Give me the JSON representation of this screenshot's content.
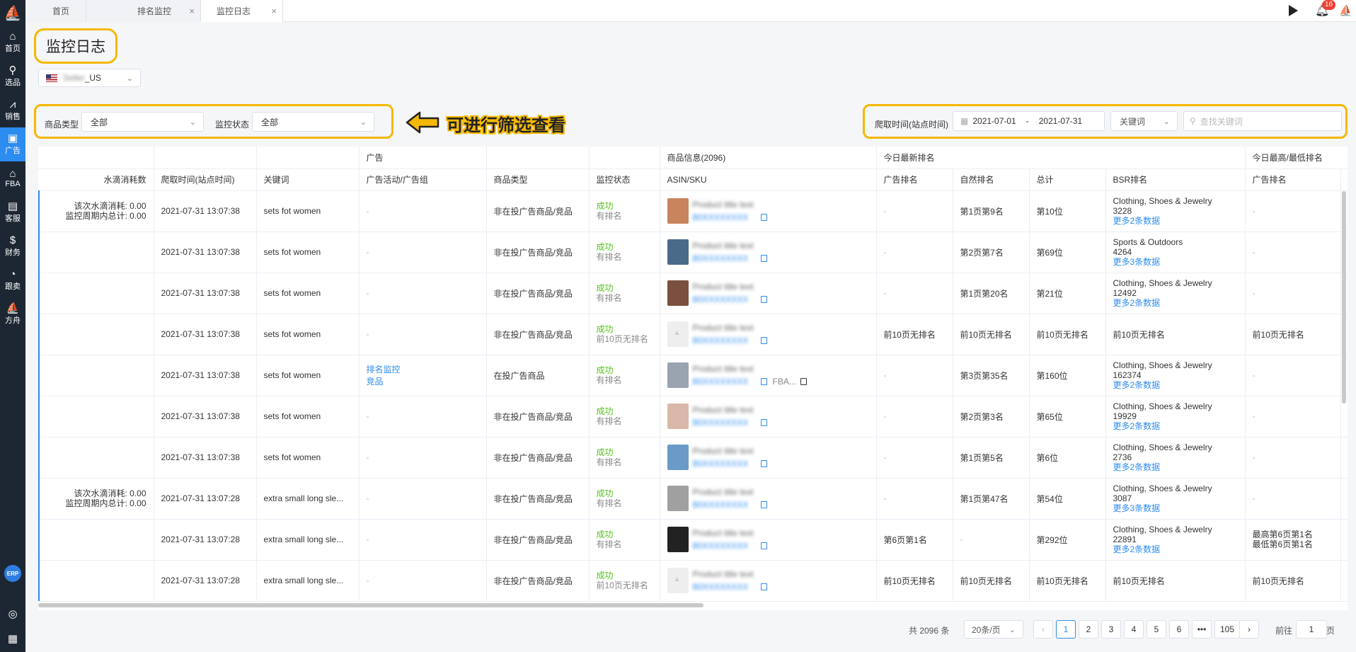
{
  "sidebar": [
    {
      "label": "首页",
      "icon": "home-icon",
      "glyph": "⌂"
    },
    {
      "label": "选品",
      "icon": "search-icon",
      "glyph": "⚲"
    },
    {
      "label": "销售",
      "icon": "chart-icon",
      "glyph": "⩘"
    },
    {
      "label": "广告",
      "icon": "ad-icon",
      "glyph": "▣"
    },
    {
      "label": "FBA",
      "icon": "warehouse-icon",
      "glyph": "⌂"
    },
    {
      "label": "客服",
      "icon": "service-icon",
      "glyph": "▤"
    },
    {
      "label": "财务",
      "icon": "finance-icon",
      "glyph": "$"
    },
    {
      "label": "跟卖",
      "icon": "follow-icon",
      "glyph": "◔"
    },
    {
      "label": "方舟",
      "icon": "ark-icon",
      "glyph": "⛵"
    }
  ],
  "erp_label": "ERP",
  "tabs": [
    {
      "label": "首页"
    },
    {
      "label": "排名监控"
    },
    {
      "label": "监控日志"
    }
  ],
  "notifications": "16",
  "page_title": "监控日志",
  "market": {
    "suffix": "_US"
  },
  "filters": {
    "type_label": "商品类型",
    "type_value": "全部",
    "status_label": "监控状态",
    "status_value": "全部",
    "note": "可进行筛选查看",
    "crawl_label": "爬取时间(站点时间)",
    "date_start": "2021-07-01",
    "date_sep": "-",
    "date_end": "2021-07-31",
    "kw_select": "关键词",
    "search_placeholder": "查找关键词"
  },
  "table": {
    "group_headers": {
      "ad": "广告",
      "product": "商品信息(2096)",
      "latest": "今日最新排名",
      "hilo": "今日最高/最低排名"
    },
    "columns": [
      "水滴消耗数",
      "爬取时间(站点时间)",
      "关键词",
      "广告活动/广告组",
      "商品类型",
      "监控状态",
      "ASIN/SKU",
      "广告排名",
      "自然排名",
      "总计",
      "BSR排名",
      "广告排名"
    ],
    "rows": [
      {
        "cost1": "该次水滴消耗: 0.00",
        "cost2": "监控周期内总计: 0.00",
        "time": "2021-07-31 13:07:38",
        "kw": "sets fot women",
        "ad1": "-",
        "ad2": "",
        "ptype": "非在投广告商品/竞品",
        "s1": "成功",
        "s2": "有排名",
        "adrank": "-",
        "nat": "第1页第9名",
        "total": "第10位",
        "bsr1": "Clothing, Shoes & Jewelry",
        "bsr2": "3228",
        "bsr3": "更多2条数据",
        "hl1": "-",
        "hl2": "",
        "thumb": "#c8845c"
      },
      {
        "cost1": "",
        "cost2": "",
        "time": "2021-07-31 13:07:38",
        "kw": "sets fot women",
        "ad1": "-",
        "ad2": "",
        "ptype": "非在投广告商品/竞品",
        "s1": "成功",
        "s2": "有排名",
        "adrank": "-",
        "nat": "第2页第7名",
        "total": "第69位",
        "bsr1": "Sports & Outdoors",
        "bsr2": "4264",
        "bsr3": "更多3条数据",
        "hl1": "-",
        "hl2": "",
        "thumb": "#4a6a8a"
      },
      {
        "cost1": "",
        "cost2": "",
        "time": "2021-07-31 13:07:38",
        "kw": "sets fot women",
        "ad1": "-",
        "ad2": "",
        "ptype": "非在投广告商品/竞品",
        "s1": "成功",
        "s2": "有排名",
        "adrank": "-",
        "nat": "第1页第20名",
        "total": "第21位",
        "bsr1": "Clothing, Shoes & Jewelry",
        "bsr2": "12492",
        "bsr3": "更多2条数据",
        "hl1": "-",
        "hl2": "",
        "thumb": "#7a5040"
      },
      {
        "cost1": "",
        "cost2": "",
        "time": "2021-07-31 13:07:38",
        "kw": "sets fot women",
        "ad1": "-",
        "ad2": "",
        "ptype": "非在投广告商品/竞品",
        "s1": "成功",
        "s2": "前10页无排名",
        "adrank": "前10页无排名",
        "nat": "前10页无排名",
        "total": "前10页无排名",
        "bsr1": "前10页无排名",
        "bsr2": "",
        "bsr3": "",
        "hl1": "前10页无排名",
        "hl2": "",
        "thumb": "none"
      },
      {
        "cost1": "",
        "cost2": "",
        "time": "2021-07-31 13:07:38",
        "kw": "sets fot women",
        "ad1": "排名监控",
        "ad2": "竞品",
        "ptype": "在投广告商品",
        "s1": "成功",
        "s2": "有排名",
        "adrank": "-",
        "nat": "第3页第35名",
        "total": "第160位",
        "bsr1": "Clothing, Shoes & Jewelry",
        "bsr2": "162374",
        "bsr3": "更多2条数据",
        "hl1": "-",
        "hl2": "",
        "thumb": "#9aa3b0",
        "fba": "FBA..."
      },
      {
        "cost1": "",
        "cost2": "",
        "time": "2021-07-31 13:07:38",
        "kw": "sets fot women",
        "ad1": "-",
        "ad2": "",
        "ptype": "非在投广告商品/竞品",
        "s1": "成功",
        "s2": "有排名",
        "adrank": "-",
        "nat": "第2页第3名",
        "total": "第65位",
        "bsr1": "Clothing, Shoes & Jewelry",
        "bsr2": "19929",
        "bsr3": "更多2条数据",
        "hl1": "-",
        "hl2": "",
        "thumb": "#d8b8a8"
      },
      {
        "cost1": "",
        "cost2": "",
        "time": "2021-07-31 13:07:38",
        "kw": "sets fot women",
        "ad1": "-",
        "ad2": "",
        "ptype": "非在投广告商品/竞品",
        "s1": "成功",
        "s2": "有排名",
        "adrank": "-",
        "nat": "第1页第5名",
        "total": "第6位",
        "bsr1": "Clothing, Shoes & Jewelry",
        "bsr2": "2736",
        "bsr3": "更多2条数据",
        "hl1": "-",
        "hl2": "",
        "thumb": "#6a9ac8"
      },
      {
        "cost1": "该次水滴消耗: 0.00",
        "cost2": "监控周期内总计: 0.00",
        "time": "2021-07-31 13:07:28",
        "kw": "extra small long sle...",
        "ad1": "-",
        "ad2": "",
        "ptype": "非在投广告商品/竞品",
        "s1": "成功",
        "s2": "有排名",
        "adrank": "-",
        "nat": "第1页第47名",
        "total": "第54位",
        "bsr1": "Clothing, Shoes & Jewelry",
        "bsr2": "3087",
        "bsr3": "更多3条数据",
        "hl1": "-",
        "hl2": "",
        "thumb": "#a0a0a0"
      },
      {
        "cost1": "",
        "cost2": "",
        "time": "2021-07-31 13:07:28",
        "kw": "extra small long sle...",
        "ad1": "-",
        "ad2": "",
        "ptype": "非在投广告商品/竞品",
        "s1": "成功",
        "s2": "有排名",
        "adrank": "第6页第1名",
        "nat": "-",
        "total": "第292位",
        "bsr1": "Clothing, Shoes & Jewelry",
        "bsr2": "22891",
        "bsr3": "更多2条数据",
        "hl1": "最高第6页第1名",
        "hl2": "最低第6页第1名",
        "thumb": "#222222"
      },
      {
        "cost1": "",
        "cost2": "",
        "time": "2021-07-31 13:07:28",
        "kw": "extra small long sle...",
        "ad1": "-",
        "ad2": "",
        "ptype": "非在投广告商品/竞品",
        "s1": "成功",
        "s2": "前10页无排名",
        "adrank": "前10页无排名",
        "nat": "前10页无排名",
        "total": "前10页无排名",
        "bsr1": "前10页无排名",
        "bsr2": "",
        "bsr3": "",
        "hl1": "前10页无排名",
        "hl2": "",
        "thumb": "none"
      }
    ]
  },
  "pager": {
    "total": "共 2096 条",
    "page_size": "20条/页",
    "pages": [
      "1",
      "2",
      "3",
      "4",
      "5",
      "6",
      "•••",
      "105"
    ],
    "goto_label": "前往",
    "goto_value": "1",
    "page_unit": "页"
  }
}
